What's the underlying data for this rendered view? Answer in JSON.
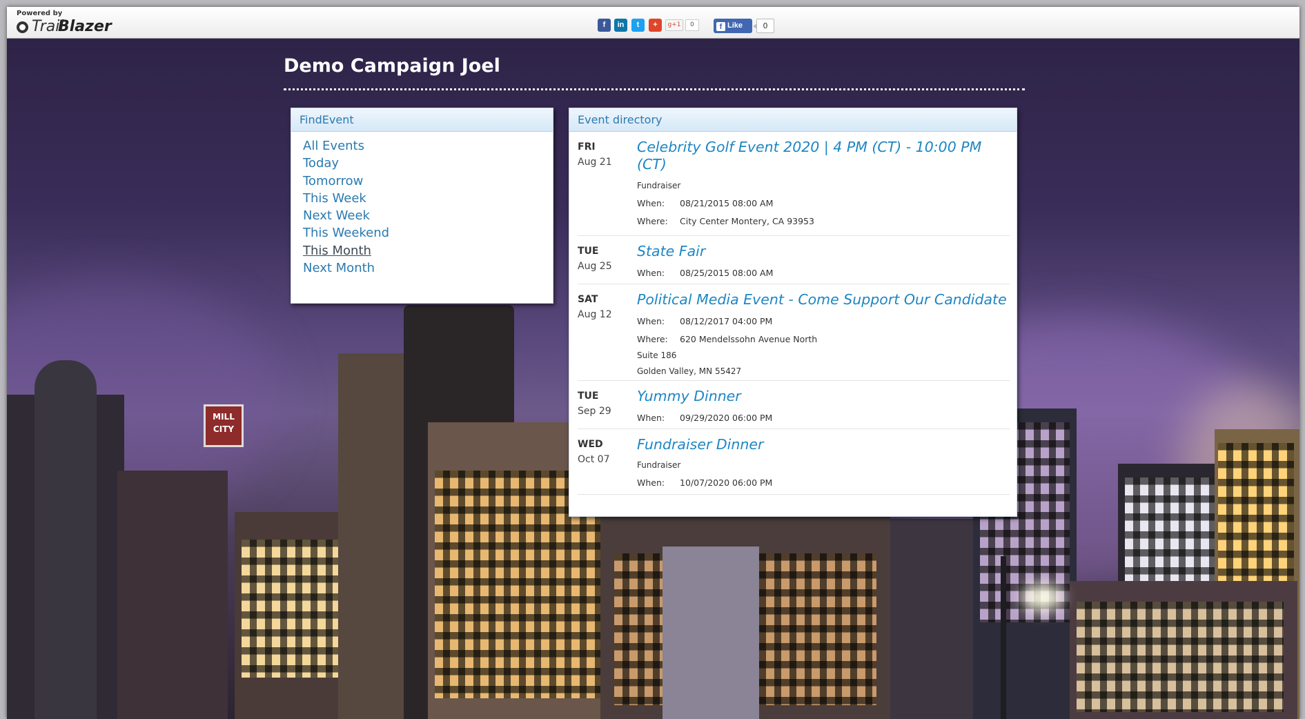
{
  "topbar": {
    "powered_by": "Powered by",
    "brand_part1": "Trail",
    "brand_part2": "Blazer",
    "share_label": "Share",
    "gplus_label": "g+1",
    "gplus_count": "0",
    "fb_like_label": "Like",
    "fb_count": "0"
  },
  "page": {
    "title": "Demo Campaign Joel"
  },
  "find_event": {
    "heading": "FindEvent",
    "items": [
      {
        "label": "All Events",
        "active": false
      },
      {
        "label": "Today",
        "active": false
      },
      {
        "label": "Tomorrow",
        "active": false
      },
      {
        "label": "This Week",
        "active": false
      },
      {
        "label": "Next Week",
        "active": false
      },
      {
        "label": "This Weekend",
        "active": false
      },
      {
        "label": "This Month",
        "active": true
      },
      {
        "label": "Next Month",
        "active": false
      }
    ]
  },
  "event_directory": {
    "heading": "Event directory",
    "when_label": "When:",
    "where_label": "Where:",
    "events": [
      {
        "day": "FRI",
        "date": "Aug 21",
        "title_line1": "Celebrity Golf Event 2020 | 4 PM (CT) - 10:00 PM",
        "title_line2": "(CT)",
        "type": "Fundraiser",
        "when": "08/21/2015 08:00 AM",
        "where": "City Center Montery, CA 93953"
      },
      {
        "day": "TUE",
        "date": "Aug 25",
        "title": "State Fair",
        "when": "08/25/2015 08:00 AM"
      },
      {
        "day": "SAT",
        "date": "Aug 12",
        "title": "Political Media Event - Come Support Our Candidate",
        "when": "08/12/2017 04:00 PM",
        "where": "620 Mendelssohn Avenue North",
        "where_line2": "Suite 186",
        "where_line3": "Golden Valley, MN 55427"
      },
      {
        "day": "TUE",
        "date": "Sep 29",
        "title": "Yummy Dinner",
        "when": "09/29/2020 06:00 PM"
      },
      {
        "day": "WED",
        "date": "Oct 07",
        "title": "Fundraiser Dinner",
        "type": "Fundraiser",
        "when": "10/07/2020 06:00 PM"
      }
    ]
  },
  "colors": {
    "link": "#2a7ab0",
    "event_title": "#1d86c4",
    "facebook": "#4267b2",
    "linkedin": "#0e76a8",
    "twitter": "#1da1f2",
    "addthis": "#e0452a"
  }
}
